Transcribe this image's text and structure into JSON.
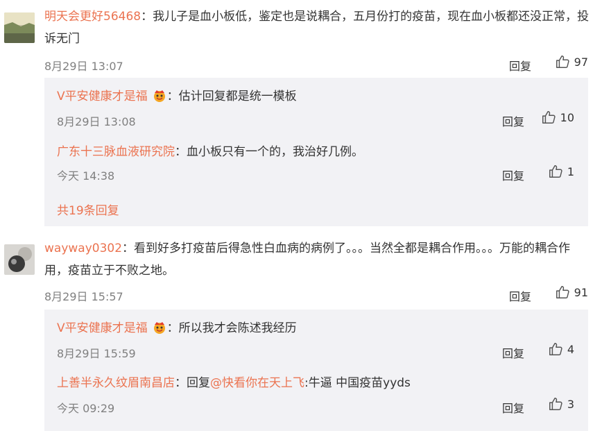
{
  "colors": {
    "accent": "#eb7350",
    "panel": "#f2f2f5",
    "meta": "#808080"
  },
  "comments": [
    {
      "user": "明天会更好56468",
      "text": "：我儿子是血小板低，鉴定也是说耦合，五月份打的疫苗，现在血小板都还没正常，投诉无门",
      "time": "8月29日 13:07",
      "reply_label": "回复",
      "likes": "97",
      "replies": [
        {
          "user": "V平安健康才是福",
          "badge": "crown-icon",
          "text": "：估计回复都是统一模板",
          "time": "8月29日 13:08",
          "reply_label": "回复",
          "likes": "10"
        },
        {
          "user": "广东十三脉血液研究院",
          "text": "：血小板只有一个的，我治好几例。",
          "time": "今天 14:38",
          "reply_label": "回复",
          "likes": "1"
        }
      ],
      "more_label": "共19条回复"
    },
    {
      "user": "wayway0302",
      "text": "：看到好多打疫苗后得急性白血病的病例了。。。当然全都是耦合作用。。。万能的耦合作用，疫苗立于不败之地。",
      "time": "8月29日 15:57",
      "reply_label": "回复",
      "likes": "91",
      "replies": [
        {
          "user": "V平安健康才是福",
          "badge": "crown-icon",
          "text": "：所以我才会陈述我经历",
          "time": "8月29日 15:59",
          "reply_label": "回复",
          "likes": "4"
        },
        {
          "user": "上善半永久纹眉南昌店",
          "text_prefix": "：回复",
          "mention": "@快看你在天上飞",
          "text": ":牛逼 中国疫苗yyds",
          "time": "今天 09:29",
          "reply_label": "回复",
          "likes": "3"
        }
      ]
    }
  ]
}
